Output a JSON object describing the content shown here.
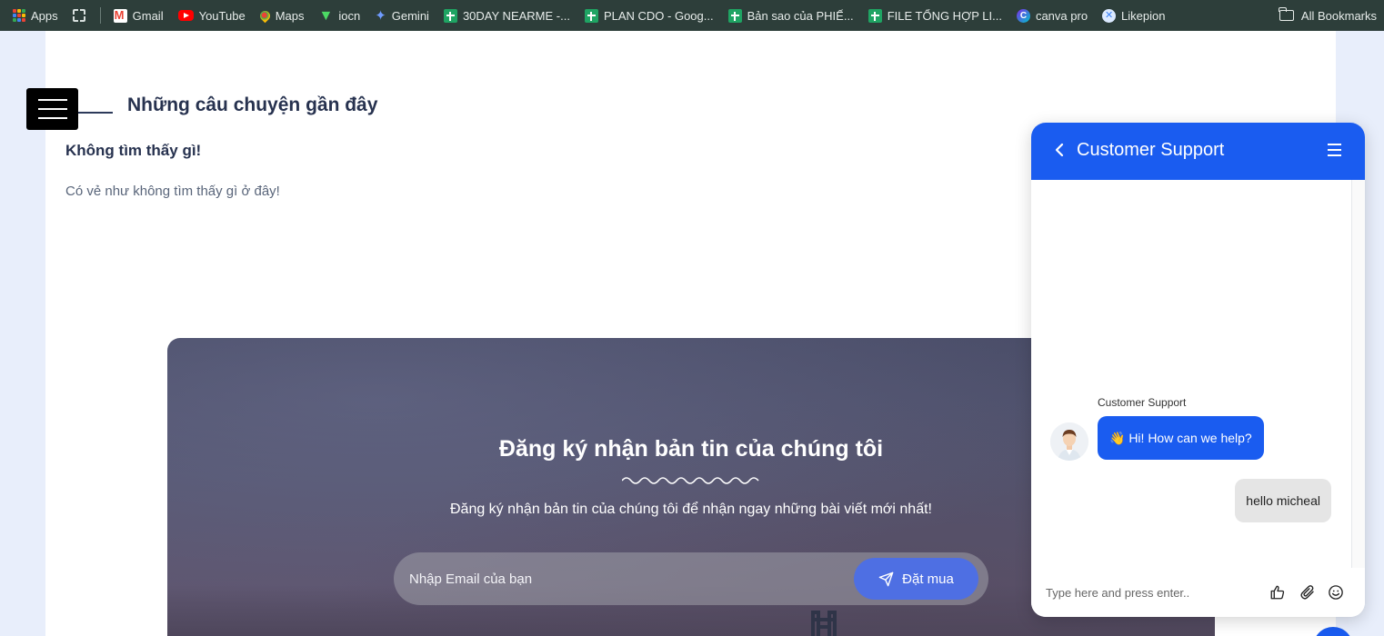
{
  "bookmarks": {
    "items": [
      {
        "label": "Apps",
        "icon": "apps-icon"
      },
      {
        "label": "Gmail",
        "icon": "gmail-icon"
      },
      {
        "label": "YouTube",
        "icon": "youtube-icon"
      },
      {
        "label": "Maps",
        "icon": "maps-icon"
      },
      {
        "label": "iocn",
        "icon": "iocn-icon"
      },
      {
        "label": "Gemini",
        "icon": "gemini-icon"
      },
      {
        "label": "30DAY NEARME -...",
        "icon": "sheets-icon"
      },
      {
        "label": "PLAN CDO - Goog...",
        "icon": "sheets-icon"
      },
      {
        "label": "Bản sao của PHIẾ...",
        "icon": "sheets-icon"
      },
      {
        "label": "FILE TỔNG HỢP LI...",
        "icon": "sheets-icon"
      },
      {
        "label": "canva pro",
        "icon": "canva-icon"
      },
      {
        "label": "Likepion",
        "icon": "likepion-icon"
      }
    ],
    "all_bookmarks": "All Bookmarks"
  },
  "content": {
    "section_title": "Những câu chuyện gần đây",
    "empty_title": "Không tìm thấy gì!",
    "empty_desc": "Có vẻ như không tìm thấy gì ở đây!"
  },
  "newsletter": {
    "title": "Đăng ký nhận bản tin của chúng tôi",
    "description": "Đăng ký nhận bản tin của chúng tôi để nhận ngay những bài viết mới nhất!",
    "email_placeholder": "Nhập Email của bạn",
    "email_value": "",
    "subscribe_label": "Đặt mua"
  },
  "chat": {
    "title": "Customer Support",
    "agent_name": "Customer Support",
    "messages": [
      {
        "from": "agent",
        "text": "👋 Hi! How can we help?"
      },
      {
        "from": "user",
        "text": "hello micheal"
      }
    ],
    "input_placeholder": "Type here and press enter..",
    "input_value": ""
  },
  "colors": {
    "bookmarks_bar": "#2d3e3a",
    "chat_accent": "#1a5cf0",
    "subscribe_button": "#4e6fe3",
    "heading": "#27324f"
  }
}
